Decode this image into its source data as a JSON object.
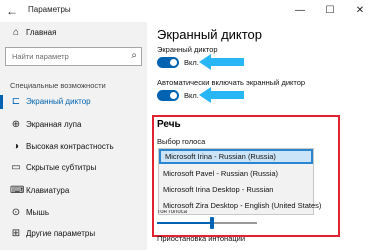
{
  "window": {
    "title": "Параметры",
    "back_glyph": "←",
    "minimize_glyph": "—",
    "maximize_glyph": "☐",
    "close_glyph": "✕"
  },
  "sidebar": {
    "home": {
      "label": "Главная",
      "icon": "home-icon",
      "glyph": "⌂"
    },
    "search": {
      "placeholder": "Найти параметр",
      "icon": "search-icon",
      "glyph": "⌕"
    },
    "section_label": "Специальные возможности",
    "items": [
      {
        "label": "Экранный диктор",
        "icon": "narrator-icon",
        "glyph": "⊏",
        "active": true
      },
      {
        "label": "Экранная лупа",
        "icon": "magnifier-icon",
        "glyph": "⊕",
        "active": false
      },
      {
        "label": "Высокая контрастность",
        "icon": "contrast-icon",
        "glyph": "◑",
        "active": false
      },
      {
        "label": "Скрытые субтитры",
        "icon": "captions-icon",
        "glyph": "▭",
        "active": false
      },
      {
        "label": "Клавиатура",
        "icon": "keyboard-icon",
        "glyph": "⌨",
        "active": false
      },
      {
        "label": "Мышь",
        "icon": "mouse-icon",
        "glyph": "⊙",
        "active": false
      },
      {
        "label": "Другие параметры",
        "icon": "other-settings-icon",
        "glyph": "⊞",
        "active": false
      }
    ]
  },
  "main": {
    "title": "Экранный диктор",
    "narrator_toggle": {
      "label": "Экранный диктор",
      "state": "Вкл.",
      "on": true
    },
    "auto_start_toggle": {
      "label": "Автоматически включать экранный диктор",
      "state": "Вкл.",
      "on": true
    },
    "speech_heading": "Речь",
    "voice_label": "Выбор голоса",
    "voice_options": [
      {
        "label": "Microsoft Irina - Russian (Russia)",
        "selected": true
      },
      {
        "label": "Microsoft Pavel - Russian (Russia)",
        "selected": false
      },
      {
        "label": "Microsoft Irina Desktop - Russian",
        "selected": false
      },
      {
        "label": "Microsoft Zira Desktop - English (United States)",
        "selected": false
      }
    ],
    "speed_label_partial": "Тон голоса",
    "intonation_label": "Приостановка интонации",
    "pitch_level": 0.55
  },
  "colors": {
    "accent": "#0063b1",
    "highlight_box": "#e0232f",
    "arrow": "#29b6f6",
    "sidebar_bg": "#f2f2f2"
  }
}
